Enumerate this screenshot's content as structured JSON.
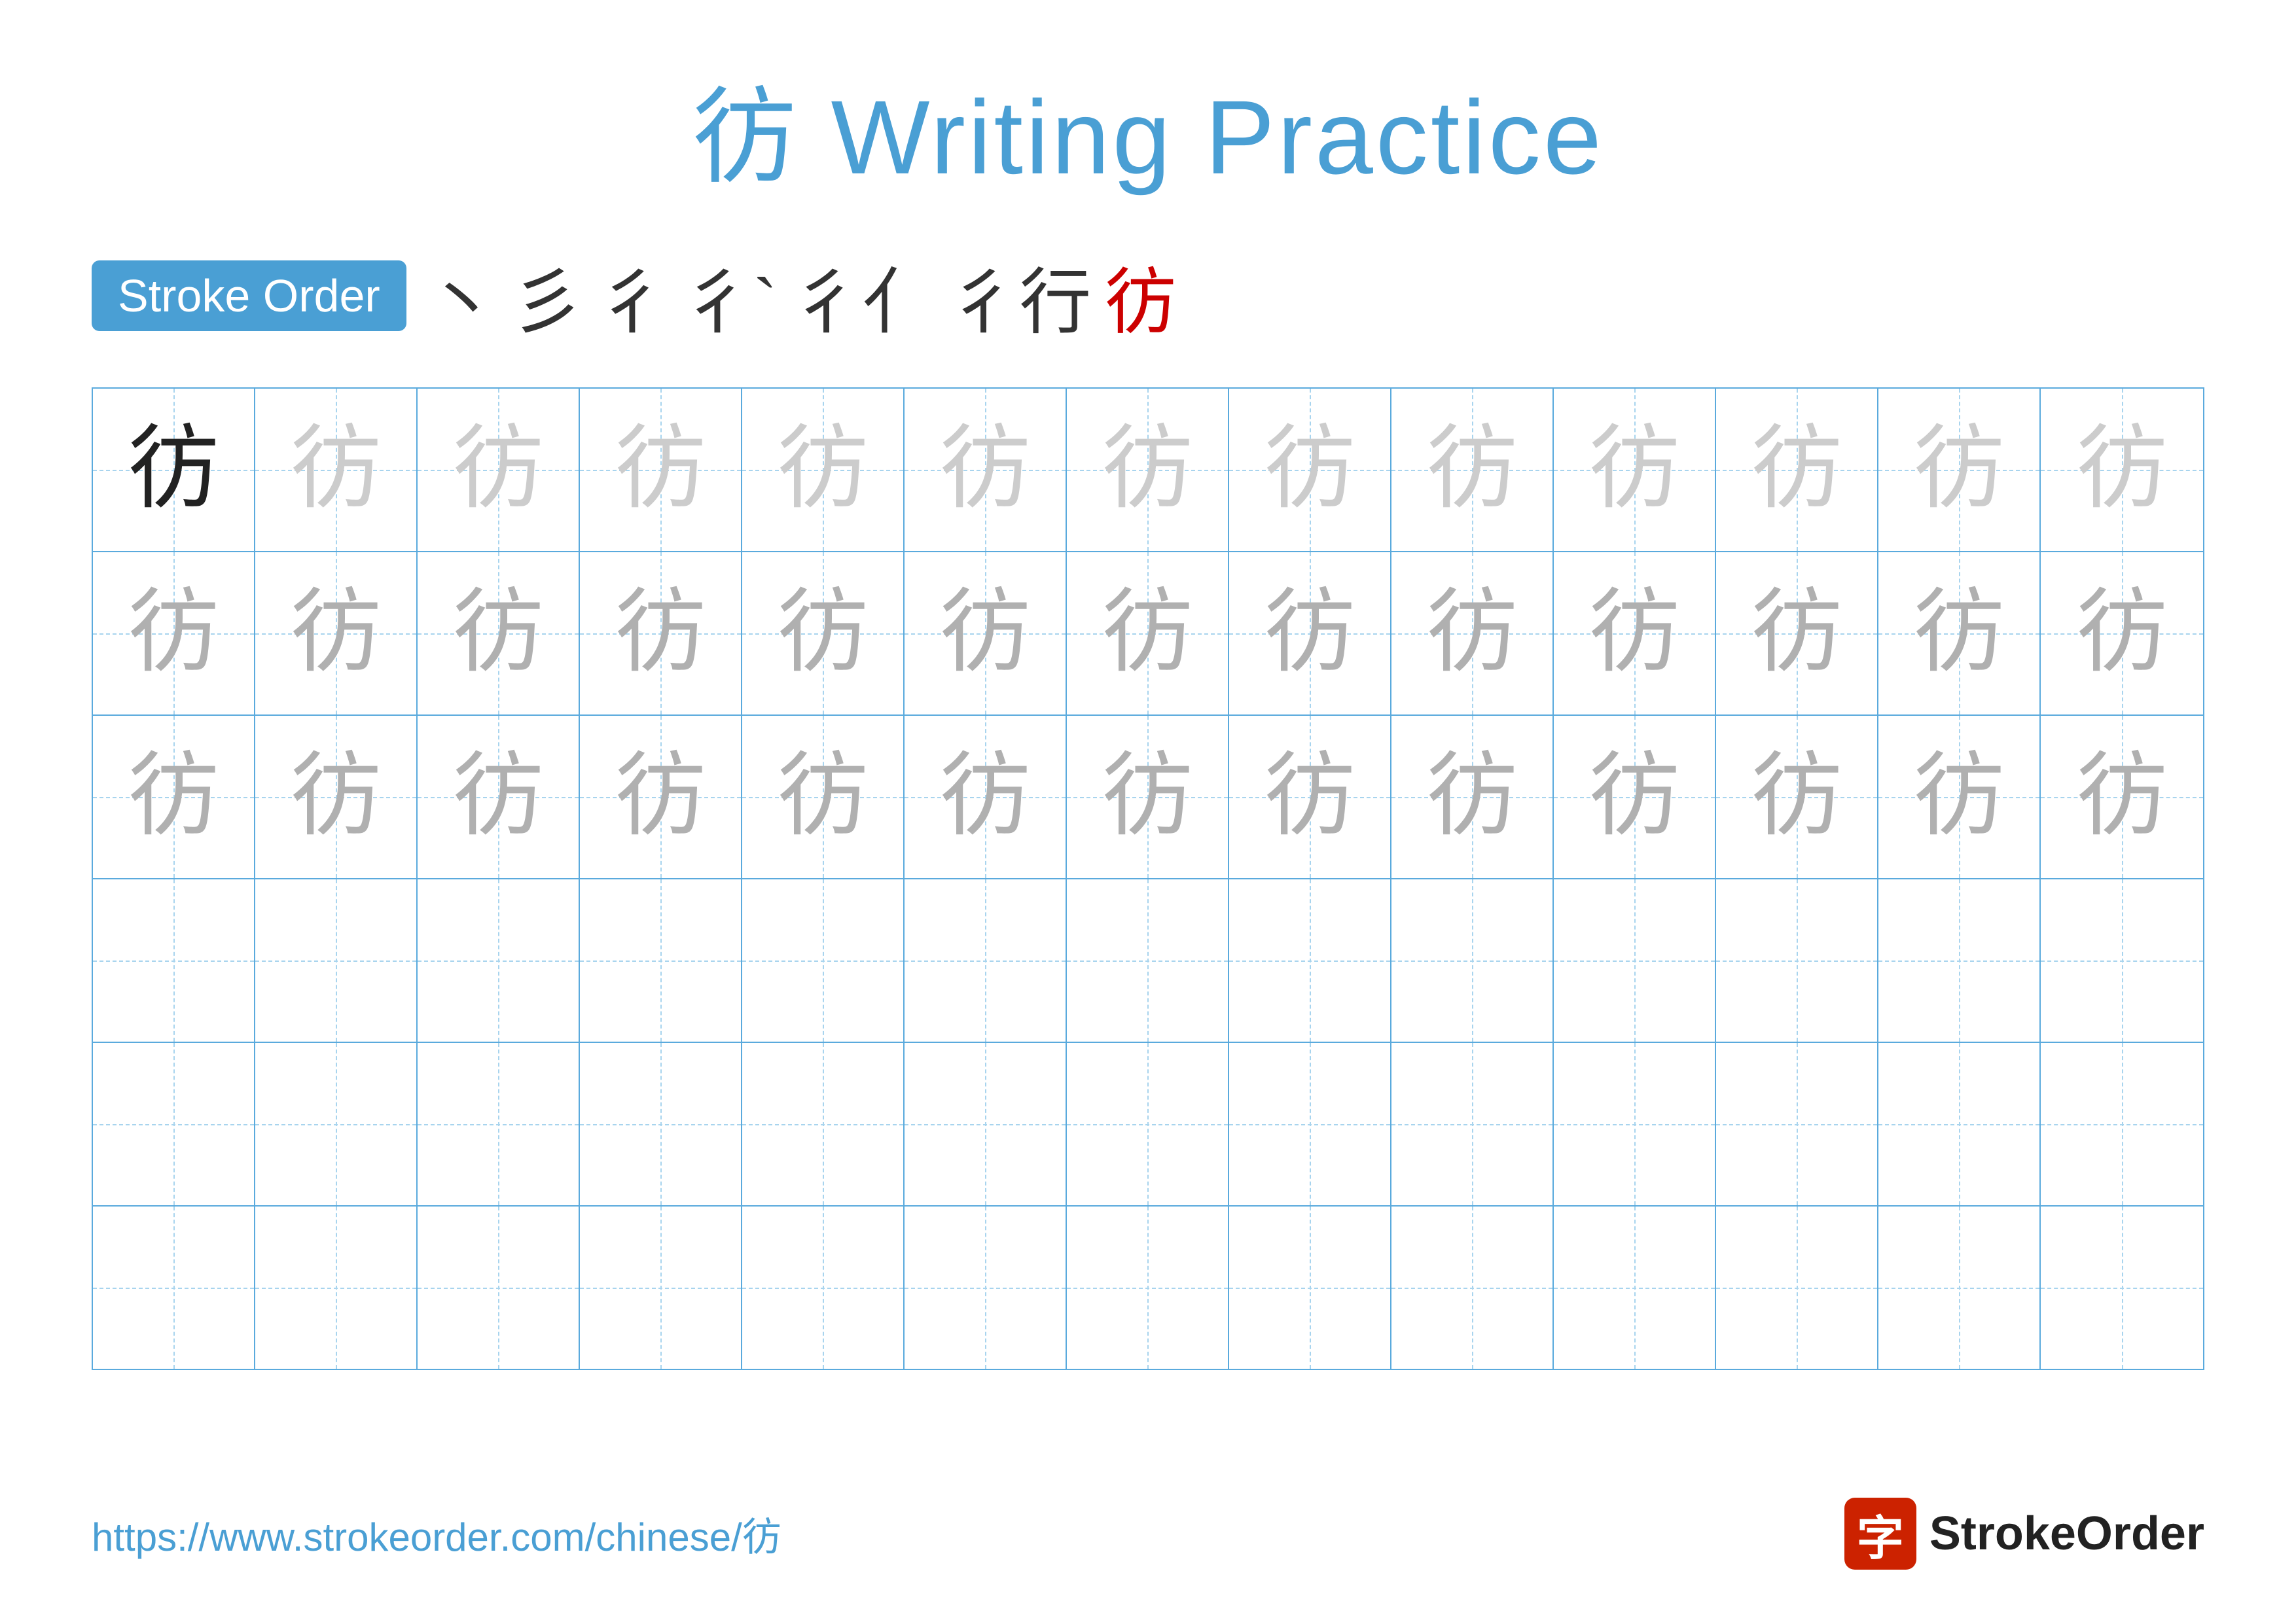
{
  "title": "彷 Writing Practice",
  "stroke_order_label": "Stroke Order",
  "strokes": [
    "丶",
    "彡",
    "彳",
    "彳丶",
    "彳亻",
    "彳行",
    "彷"
  ],
  "character": "彷",
  "url": "https://www.strokeorder.com/chinese/彷",
  "logo_char": "字",
  "logo_name": "StrokeOrder",
  "grid": {
    "rows": 6,
    "cols": 13,
    "row1": "dark+light*12",
    "row2": "medium*13",
    "row3": "medium*13",
    "row4": "empty",
    "row5": "empty",
    "row6": "empty"
  }
}
